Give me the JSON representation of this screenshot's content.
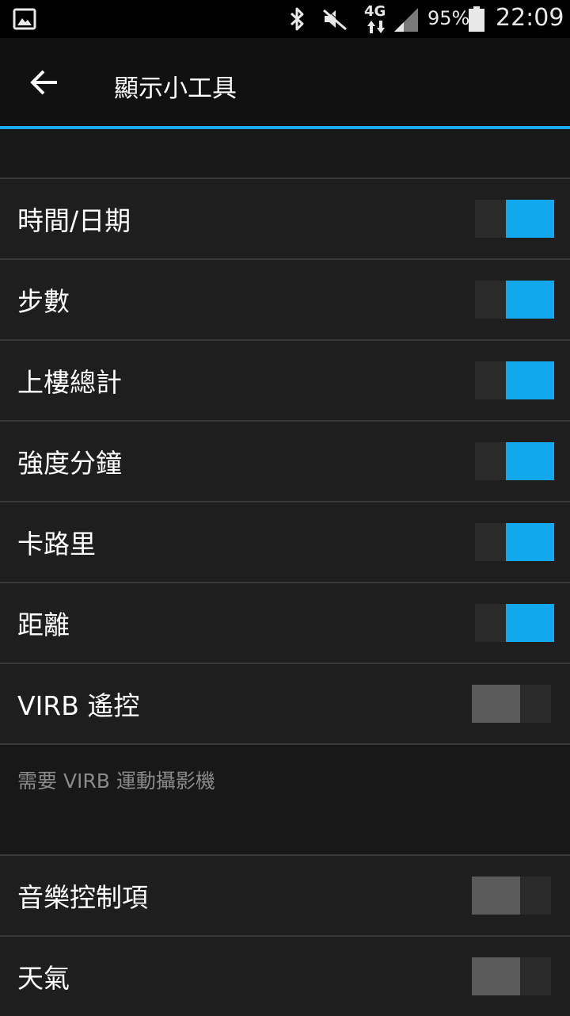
{
  "status_bar": {
    "battery_percent": "95%",
    "time": "22:09",
    "network_type": "4G",
    "icons": [
      "gallery-icon",
      "bluetooth-icon",
      "mute-icon",
      "network-4g-icon",
      "signal-icon",
      "battery-icon"
    ]
  },
  "app_bar": {
    "title": "顯示小工具",
    "back_icon": "arrow-left-icon"
  },
  "colors": {
    "accent": "#1ea9ee",
    "toggle_on": "#12a8ee",
    "toggle_off": "#5a5a5a"
  },
  "widgets": [
    {
      "label": "時間/日期",
      "enabled": true
    },
    {
      "label": "步數",
      "enabled": true
    },
    {
      "label": "上樓總計",
      "enabled": true
    },
    {
      "label": "強度分鐘",
      "enabled": true
    },
    {
      "label": "卡路里",
      "enabled": true
    },
    {
      "label": "距離",
      "enabled": true
    },
    {
      "label": "VIRB 遙控",
      "enabled": false
    }
  ],
  "virb_note": "需要 VIRB 運動攝影機",
  "widgets_more": [
    {
      "label": "音樂控制項",
      "enabled": false
    },
    {
      "label": "天氣",
      "enabled": false
    }
  ]
}
